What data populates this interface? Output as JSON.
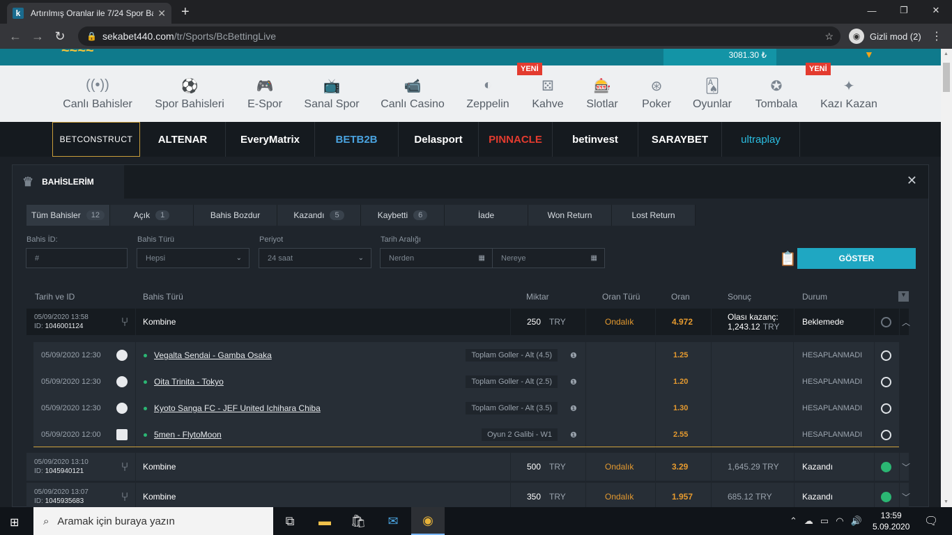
{
  "browser": {
    "tab_title": "Artırılmış Oranlar ile 7/24 Spor Ba",
    "favicon_letter": "k",
    "url_host": "sekabet440.com",
    "url_path": "/tr/Sports/BcBettingLive",
    "incognito_label": "Gizli mod (2)"
  },
  "site": {
    "balance": "3081.30 ₺",
    "categories": [
      {
        "label": "Canlı Bahisler",
        "icon": "live-icon",
        "glyph": "((•))"
      },
      {
        "label": "Spor Bahisleri",
        "icon": "ball-icon",
        "glyph": "⚽"
      },
      {
        "label": "E-Spor",
        "icon": "gamepad-icon",
        "glyph": "🎮"
      },
      {
        "label": "Sanal Spor",
        "icon": "tv-icon",
        "glyph": "📺"
      },
      {
        "label": "Canlı Casino",
        "icon": "camera-icon",
        "glyph": "📹"
      },
      {
        "label": "Zeppelin",
        "icon": "zeppelin-icon",
        "glyph": "◐"
      },
      {
        "label": "Kahve",
        "icon": "dice-icon",
        "glyph": "⚄"
      },
      {
        "label": "Slotlar",
        "icon": "slot-icon",
        "glyph": "🎰"
      },
      {
        "label": "Poker",
        "icon": "chip-icon",
        "glyph": "⊛"
      },
      {
        "label": "Oyunlar",
        "icon": "cards-icon",
        "glyph": "🂡"
      },
      {
        "label": "Tombala",
        "icon": "star-icon",
        "glyph": "✪"
      },
      {
        "label": "Kazı Kazan",
        "icon": "scratch-icon",
        "glyph": "✦"
      }
    ],
    "badge_new": "YENİ",
    "providers": [
      "BETCONSTRUCT",
      "ALTENAR",
      "EveryMatrix",
      "BETB2B",
      "Delasport",
      "PINNACLE",
      "betinvest",
      "SARAYBET",
      "ultraplay"
    ]
  },
  "modal": {
    "title": "BAHİSLERİM",
    "tabs": [
      {
        "label": "Tüm Bahisler",
        "count": "12"
      },
      {
        "label": "Açık",
        "count": "1"
      },
      {
        "label": "Bahis Bozdur",
        "count": ""
      },
      {
        "label": "Kazandı",
        "count": "5"
      },
      {
        "label": "Kaybetti",
        "count": "6"
      },
      {
        "label": "İade",
        "count": ""
      },
      {
        "label": "Won Return",
        "count": ""
      },
      {
        "label": "Lost Return",
        "count": ""
      }
    ],
    "filters": {
      "bet_id_label": "Bahis İD:",
      "bet_id_placeholder": "#",
      "bet_type_label": "Bahis Türü",
      "bet_type_value": "Hepsi",
      "period_label": "Periyot",
      "period_value": "24 saat",
      "date_label": "Tarih Aralığı",
      "from_placeholder": "Nerden",
      "to_placeholder": "Nereye",
      "show_button": "GÖSTER"
    },
    "columns": [
      "Tarih ve ID",
      "Bahis Türü",
      "Miktar",
      "Oran Türü",
      "Oran",
      "Sonuç",
      "Durum"
    ],
    "bets": [
      {
        "datetime": "05/09/2020 13:58",
        "id_label": "ID:",
        "id": "1046001124",
        "type": "Kombine",
        "amount": "250",
        "currency": "TRY",
        "odds_type": "Ondalık",
        "odds": "4.972",
        "result_label": "Olası kazanç:",
        "result": "1,243.12",
        "status": "Beklemede"
      },
      {
        "datetime": "05/09/2020 13:10",
        "id_label": "ID:",
        "id": "1045940121",
        "type": "Kombine",
        "amount": "500",
        "currency": "TRY",
        "odds_type": "Ondalık",
        "odds": "3.29",
        "result": "1,645.29 TRY",
        "status": "Kazandı"
      },
      {
        "datetime": "05/09/2020 13:07",
        "id_label": "ID:",
        "id": "1045935683",
        "type": "Kombine",
        "amount": "350",
        "currency": "TRY",
        "odds_type": "Ondalık",
        "odds": "1.957",
        "result": "685.12 TRY",
        "status": "Kazandı"
      }
    ],
    "selections": [
      {
        "datetime": "05/09/2020 12:30",
        "sport": "football",
        "match": "Vegalta Sendai - Gamba Osaka",
        "market": "Toplam Goller - Alt (4.5)",
        "odds": "1.25",
        "status": "HESAPLANMADI"
      },
      {
        "datetime": "05/09/2020 12:30",
        "sport": "football",
        "match": "Oita Trinita - Tokyo",
        "market": "Toplam Goller - Alt (2.5)",
        "odds": "1.20",
        "status": "HESAPLANMADI"
      },
      {
        "datetime": "05/09/2020 12:30",
        "sport": "football",
        "match": "Kyoto Sanga FC - JEF United Ichihara Chiba",
        "market": "Toplam Goller - Alt (3.5)",
        "odds": "1.30",
        "status": "HESAPLANMADI"
      },
      {
        "datetime": "05/09/2020 12:00",
        "sport": "dota",
        "match": "5men - FlytoMoon",
        "market": "Oyun 2 Galibi - W1",
        "odds": "2.55",
        "status": "HESAPLANMADI"
      }
    ]
  },
  "taskbar": {
    "search_placeholder": "Aramak için buraya yazın",
    "time": "13:59",
    "date": "5.09.2020"
  }
}
